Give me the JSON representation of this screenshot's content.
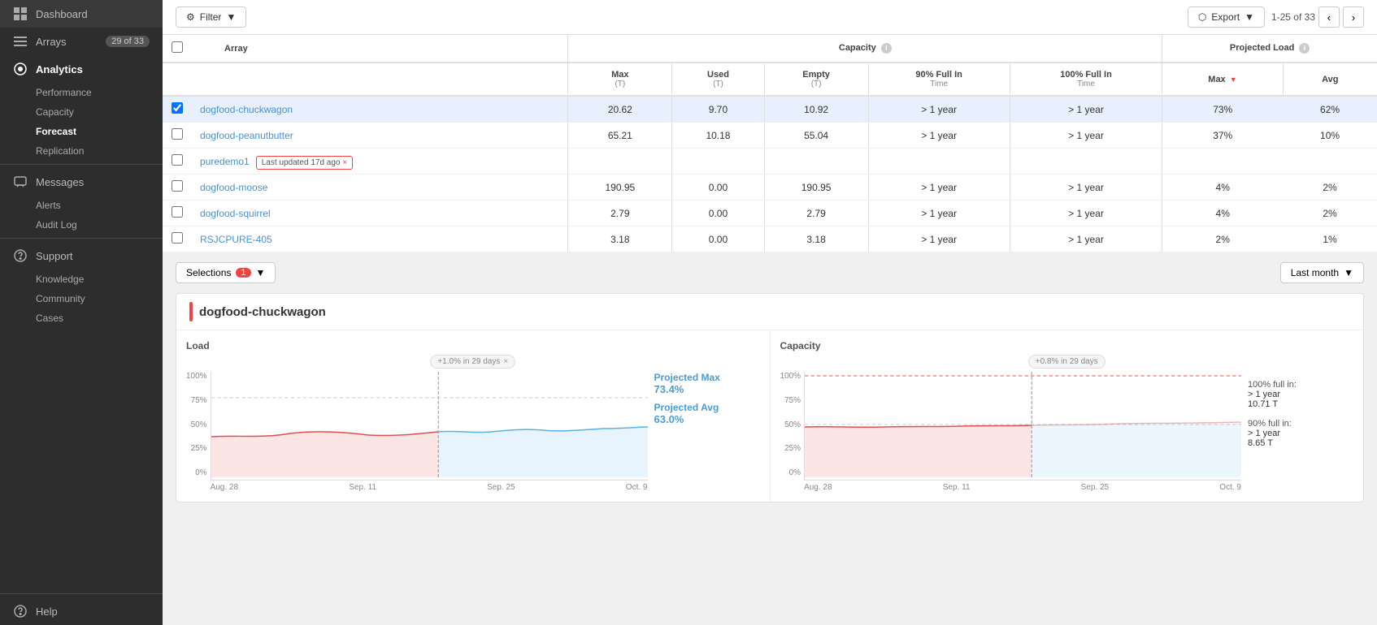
{
  "sidebar": {
    "dashboard_label": "Dashboard",
    "arrays_label": "Arrays",
    "arrays_badge": "29 of 33",
    "analytics_label": "Analytics",
    "performance_label": "Performance",
    "capacity_label": "Capacity",
    "forecast_label": "Forecast",
    "replication_label": "Replication",
    "messages_label": "Messages",
    "alerts_label": "Alerts",
    "audit_log_label": "Audit Log",
    "support_label": "Support",
    "knowledge_label": "Knowledge",
    "community_label": "Community",
    "cases_label": "Cases",
    "help_label": "Help"
  },
  "toolbar": {
    "filter_label": "Filter",
    "export_label": "Export",
    "pagination_text": "1-25 of 33"
  },
  "table": {
    "col_array": "Array",
    "col_capacity": "Capacity",
    "col_projected_load": "Projected Load",
    "col_max": "Max",
    "col_max_unit": "(T)",
    "col_used": "Used",
    "col_used_unit": "(T)",
    "col_empty": "Empty",
    "col_empty_unit": "(T)",
    "col_90_full": "90% Full In",
    "col_90_full_sub": "Time",
    "col_100_full": "100% Full In",
    "col_100_full_sub": "Time",
    "col_pl_max": "Max",
    "col_pl_avg": "Avg",
    "rows": [
      {
        "id": "r1",
        "name": "dogfood-chuckwagon",
        "max": "20.62",
        "used": "9.70",
        "empty": "10.92",
        "full90": "> 1 year",
        "full100": "> 1 year",
        "pl_max": "73%",
        "pl_avg": "62%",
        "selected": true
      },
      {
        "id": "r2",
        "name": "dogfood-peanutbutter",
        "max": "65.21",
        "used": "10.18",
        "empty": "55.04",
        "full90": "> 1 year",
        "full100": "> 1 year",
        "pl_max": "37%",
        "pl_avg": "10%",
        "selected": false
      },
      {
        "id": "r3",
        "name": "puredemo1",
        "max": "",
        "used": "",
        "empty": "",
        "full90": "",
        "full100": "",
        "pl_max": "",
        "pl_avg": "",
        "selected": false,
        "tooltip": "Last updated 17d ago"
      },
      {
        "id": "r4",
        "name": "dogfood-moose",
        "max": "190.95",
        "used": "0.00",
        "empty": "190.95",
        "full90": "> 1 year",
        "full100": "> 1 year",
        "pl_max": "4%",
        "pl_avg": "2%",
        "selected": false
      },
      {
        "id": "r5",
        "name": "dogfood-squirrel",
        "max": "2.79",
        "used": "0.00",
        "empty": "2.79",
        "full90": "> 1 year",
        "full100": "> 1 year",
        "pl_max": "4%",
        "pl_avg": "2%",
        "selected": false
      },
      {
        "id": "r6",
        "name": "RSJCPURE-405",
        "max": "3.18",
        "used": "0.00",
        "empty": "3.18",
        "full90": "> 1 year",
        "full100": "> 1 year",
        "pl_max": "2%",
        "pl_avg": "1%",
        "selected": false
      }
    ]
  },
  "bottom": {
    "selections_label": "Selections",
    "selections_count": "1",
    "time_range_label": "Last month"
  },
  "detail": {
    "array_name": "dogfood-chuckwagon",
    "load_chart_title": "Load",
    "capacity_chart_title": "Capacity",
    "load_annotation": "+1.0% in 29 days",
    "capacity_annotation": "+0.8% in 29 days",
    "projected_max_label": "Projected Max",
    "projected_max_value": "73.4%",
    "projected_avg_label": "Projected Avg",
    "projected_avg_value": "63.0%",
    "capacity_100_label": "100% full in:",
    "capacity_100_value": "> 1 year",
    "capacity_100_t": "10.71 T",
    "capacity_90_label": "90% full in:",
    "capacity_90_value": "> 1 year",
    "capacity_90_t": "8.65 T",
    "x_labels": [
      "Aug. 28",
      "Sep. 11",
      "Sep. 25",
      "Oct. 9"
    ],
    "y_labels_load": [
      "100%",
      "75%",
      "50%",
      "25%",
      "0%"
    ],
    "y_labels_capacity": [
      "100%",
      "75%",
      "50%",
      "25%",
      "0%"
    ]
  }
}
